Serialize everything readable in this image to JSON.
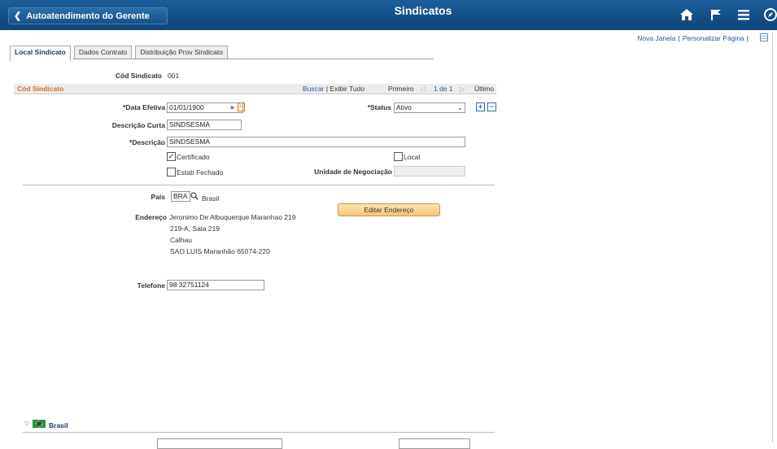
{
  "banner": {
    "back_label": "Autoatendimento do Gerente",
    "title": "Sindicatos"
  },
  "header_links": {
    "new_window": "Nova Janela",
    "personalize": "Personalizar Página"
  },
  "tabs": [
    {
      "label": "Local Sindicato"
    },
    {
      "label": "Dados Contrato"
    },
    {
      "label": "Distribuição Prov Sindicato"
    }
  ],
  "key": {
    "label": "Cód Sindicato",
    "value": "001"
  },
  "section": {
    "title": "Cód Sindicato",
    "find": "Buscar",
    "view_all": "Exibir Tudo",
    "first": "Primeiro",
    "range": "1 de 1",
    "last": "Último"
  },
  "form": {
    "effdt_label": "*Data Efetiva",
    "effdt_value": "01/01/1900",
    "status_label": "*Status",
    "status_value": "Ativo",
    "short_desc_label": "Descrição Curta",
    "short_desc_value": "SINDSESMA",
    "desc_label": "*Descrição",
    "desc_value": "SINDSESMA",
    "certified_label": "Certificado",
    "local_label": "Local",
    "closed_label": "Estab Fechado",
    "bargaining_label": "Unidade de Negociação",
    "country_label": "País",
    "country_value": "BRA",
    "country_name": "Brasil",
    "address_label": "Endereço",
    "address_lines": [
      "Jeronimo De Albuquerque Maranhao 219",
      "219-A, Sala 219",
      "Calhau",
      "SAO LUIS Maranhão 65074-220"
    ],
    "edit_address_btn": "Editar Endereço",
    "phone_label": "Telefone",
    "phone_value": "98 32751124"
  },
  "footer": {
    "country_section": "Brasil"
  }
}
